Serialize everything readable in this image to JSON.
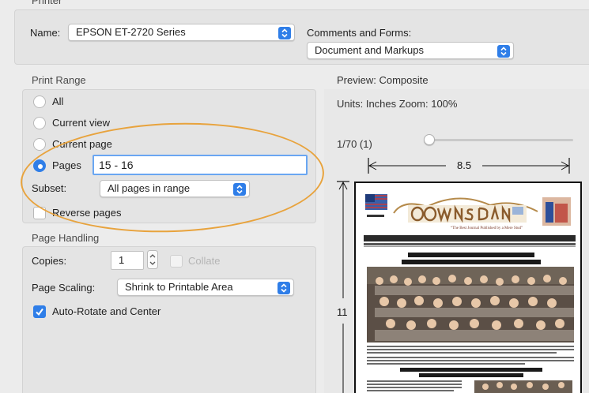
{
  "printer_section": {
    "title": "Printer",
    "name_label": "Name:",
    "name_value": "EPSON ET-2720 Series",
    "comments_label": "Comments and Forms:",
    "comments_value": "Document and Markups"
  },
  "print_range": {
    "title": "Print Range",
    "options": [
      {
        "label": "All",
        "selected": false
      },
      {
        "label": "Current view",
        "selected": false
      },
      {
        "label": "Current page",
        "selected": false
      },
      {
        "label": "Pages",
        "selected": true
      }
    ],
    "pages_value": "15 - 16",
    "subset_label": "Subset:",
    "subset_value": "All pages in range",
    "reverse_label": "Reverse pages",
    "reverse_checked": false
  },
  "page_handling": {
    "title": "Page Handling",
    "copies_label": "Copies:",
    "copies_value": "1",
    "collate_label": "Collate",
    "scaling_label": "Page Scaling:",
    "scaling_value": "Shrink to Printable Area",
    "autorotate_label": "Auto-Rotate and Center",
    "autorotate_checked": true
  },
  "preview": {
    "title": "Preview: Composite",
    "units_zoom": "Units: Inches Zoom: 100%",
    "page_counter": "1/70 (1)",
    "width_dim": "8.5",
    "height_dim": "11"
  },
  "colors": {
    "accent": "#2f7ee8",
    "highlight_circle": "#e8a33d"
  }
}
